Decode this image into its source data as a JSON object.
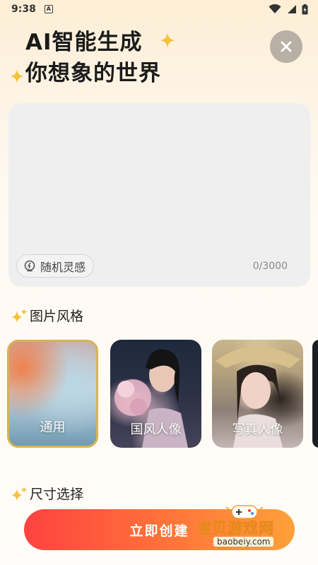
{
  "status_bar": {
    "time": "9:38",
    "notif_glyph": "A"
  },
  "hero": {
    "line1": "AI智能生成",
    "line2": "你想象的世界"
  },
  "prompt": {
    "inspire_label": "随机灵感",
    "char_count": "0/3000"
  },
  "style_section": {
    "title": "图片风格",
    "cards": [
      {
        "label": "通用",
        "selected": true
      },
      {
        "label": "国风人像",
        "selected": false
      },
      {
        "label": "写真人像",
        "selected": false
      }
    ]
  },
  "size_section": {
    "title": "尺寸选择"
  },
  "actions": {
    "create_label": "立即创建"
  },
  "watermark": {
    "text": "宝贝游戏网",
    "domain": "baobeiy.com"
  },
  "colors": {
    "accent": "#ff4341",
    "sparkle": "#f5c23a",
    "selected_border": "#d6b454"
  },
  "icons": {
    "close": "close-icon",
    "sparkle": "sparkle-icon",
    "bulb": "lightbulb-icon"
  }
}
